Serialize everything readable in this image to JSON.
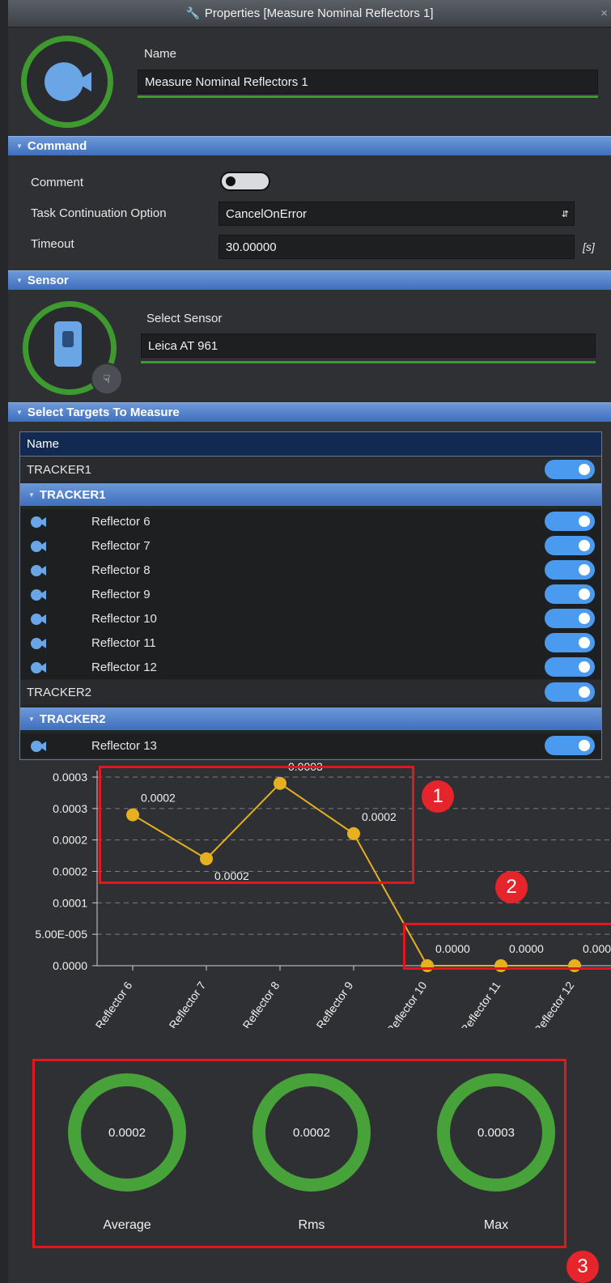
{
  "window": {
    "title": "Properties [Measure Nominal Reflectors 1]",
    "close": "×"
  },
  "header": {
    "name_label": "Name",
    "name_value": "Measure Nominal Reflectors 1"
  },
  "command": {
    "section_title": "Command",
    "comment_label": "Comment",
    "comment_toggle_on": false,
    "task_option_label": "Task Continuation Option",
    "task_option_value": "CancelOnError",
    "timeout_label": "Timeout",
    "timeout_value": "30.00000",
    "timeout_unit": "[s]"
  },
  "sensor": {
    "section_title": "Sensor",
    "select_label": "Select Sensor",
    "select_value": "Leica AT 961"
  },
  "targets": {
    "section_title": "Select Targets To Measure",
    "column_header": "Name",
    "groups": [
      {
        "name": "TRACKER1",
        "expanded_label": "TRACKER1",
        "enabled": true,
        "items": [
          {
            "label": "Reflector 6",
            "enabled": true
          },
          {
            "label": "Reflector 7",
            "enabled": true
          },
          {
            "label": "Reflector 8",
            "enabled": true
          },
          {
            "label": "Reflector 9",
            "enabled": true
          },
          {
            "label": "Reflector 10",
            "enabled": true
          },
          {
            "label": "Reflector 11",
            "enabled": true
          },
          {
            "label": "Reflector 12",
            "enabled": true
          }
        ]
      },
      {
        "name": "TRACKER2",
        "expanded_label": "TRACKER2",
        "enabled": true,
        "items": [
          {
            "label": "Reflector 13",
            "enabled": true
          }
        ]
      }
    ]
  },
  "chart_data": {
    "type": "line",
    "categories": [
      "Reflector 6",
      "Reflector 7",
      "Reflector 8",
      "Reflector 9",
      "Reflector 10",
      "Reflector 11",
      "Reflector 12"
    ],
    "values": [
      0.00024,
      0.00017,
      0.00029,
      0.00021,
      0.0,
      0.0,
      0.0
    ],
    "data_labels": [
      "0.0002",
      "0.0002",
      "0.0003",
      "0.0002",
      "0.0000",
      "0.0000",
      "0.0000"
    ],
    "y_ticks": [
      0.0,
      5e-05,
      0.0001,
      0.00015,
      0.0002,
      0.00025,
      0.0003
    ],
    "y_tick_labels": [
      "0.0000",
      "5.00E-005",
      "0.0001",
      "0.0002",
      "0.0002",
      "0.0003",
      "0.0003"
    ],
    "ylim": [
      0,
      0.0003
    ],
    "grid": true,
    "series_color": "#e6b020",
    "title": "",
    "xlabel": "",
    "ylabel": ""
  },
  "annotations": {
    "badge1": "1",
    "badge2": "2",
    "badge3": "3",
    "box_color": "#e0181f"
  },
  "stats": [
    {
      "value": "0.0002",
      "label": "Average"
    },
    {
      "value": "0.0002",
      "label": "Rms"
    },
    {
      "value": "0.0003",
      "label": "Max"
    }
  ],
  "colors": {
    "accent_green": "#3e9a2f",
    "section_blue": "#4f7fca",
    "toggle_blue": "#4a9bf0",
    "background": "#2f3033"
  },
  "icons": {
    "title": "wrench-icon",
    "header": "camera-icon",
    "sensor": "laser-tracker-icon",
    "item": "camera-icon"
  }
}
